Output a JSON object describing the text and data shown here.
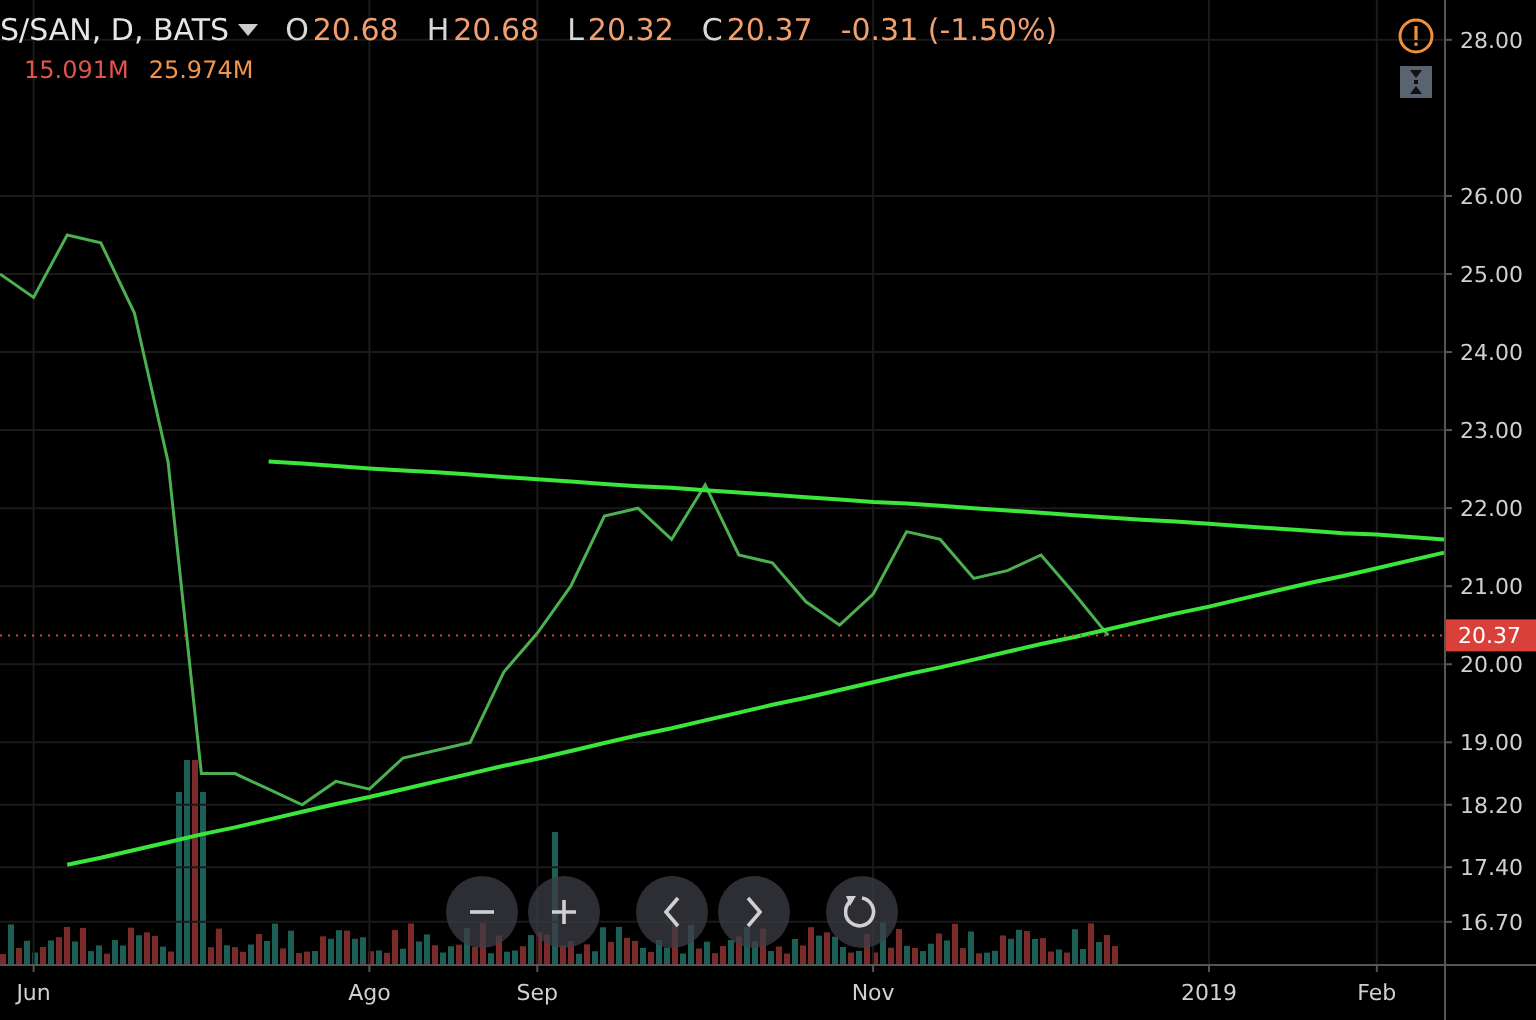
{
  "legend": {
    "symbol": "S/SAN, D, BATS",
    "ohlc": [
      {
        "label": "O",
        "value": "20.68"
      },
      {
        "label": "H",
        "value": "20.68"
      },
      {
        "label": "L",
        "value": "20.32"
      },
      {
        "label": "C",
        "value": "20.37"
      }
    ],
    "change": "-0.31 (-1.50%)",
    "volume": [
      {
        "value": "15.091M",
        "color": "#e0544f"
      },
      {
        "value": "25.974M",
        "color": "#f0954a"
      }
    ]
  },
  "chart_data": {
    "type": "line",
    "grid": true,
    "ylim": [
      16.16,
      28.51
    ],
    "categories": [
      null,
      "Jun",
      null,
      null,
      null,
      null,
      null,
      null,
      null,
      null,
      null,
      "Ago",
      null,
      null,
      null,
      null,
      "Sep",
      null,
      null,
      null,
      null,
      null,
      null,
      null,
      null,
      null,
      "Nov",
      null,
      null,
      null,
      null,
      null,
      null,
      null,
      null,
      null,
      "2019",
      null,
      null,
      null,
      null,
      "Feb",
      null,
      null
    ],
    "series": [
      {
        "color": "#4caf50",
        "values": [
          25.0,
          24.7,
          25.5,
          25.4,
          24.5,
          22.6,
          18.6,
          18.6,
          18.4,
          18.2,
          18.5,
          18.4,
          18.8,
          18.9,
          19.0,
          19.9,
          20.4,
          21.0,
          21.9,
          22.0,
          21.6,
          22.3,
          21.4,
          21.3,
          20.8,
          20.5,
          20.9,
          21.7,
          21.6,
          21.1,
          21.2,
          21.4,
          20.9,
          20.37,
          null,
          null,
          null,
          null,
          null,
          null,
          null,
          null,
          null,
          null
        ]
      },
      {
        "color": "#39e639",
        "values": [
          null,
          null,
          null,
          null,
          null,
          null,
          null,
          null,
          22.6,
          22.57,
          22.54,
          22.51,
          22.48,
          22.46,
          22.43,
          22.4,
          22.37,
          22.34,
          22.31,
          22.28,
          22.26,
          22.23,
          22.2,
          22.17,
          22.14,
          22.11,
          22.08,
          22.06,
          22.03,
          22.0,
          21.97,
          21.94,
          21.91,
          21.88,
          21.85,
          21.83,
          21.8,
          21.77,
          21.74,
          21.71,
          21.68,
          21.66,
          21.63,
          21.6
        ]
      },
      {
        "color": "#39e639",
        "values": [
          null,
          null,
          17.43,
          17.52,
          17.62,
          17.72,
          17.82,
          17.91,
          18.01,
          18.11,
          18.21,
          18.3,
          18.4,
          18.5,
          18.6,
          18.7,
          18.79,
          18.89,
          18.99,
          19.09,
          19.18,
          19.28,
          19.38,
          19.48,
          19.57,
          19.67,
          19.77,
          19.87,
          19.96,
          20.06,
          20.16,
          20.26,
          20.35,
          20.45,
          20.55,
          20.65,
          20.74,
          20.84,
          20.94,
          21.04,
          21.13,
          21.23,
          21.33,
          21.43
        ]
      }
    ],
    "yticks": [
      {
        "value": 28,
        "label": "28.00"
      },
      {
        "value": 26,
        "label": "26.00"
      },
      {
        "value": 25,
        "label": "25.00"
      },
      {
        "value": 24,
        "label": "24.00"
      },
      {
        "value": 23,
        "label": "23.00"
      },
      {
        "value": 22,
        "label": "22.00"
      },
      {
        "value": 21,
        "label": "21.00"
      },
      {
        "value": 20,
        "label": "20.00"
      },
      {
        "value": 19,
        "label": "19.00"
      },
      {
        "value": 18.2,
        "label": "18.20"
      },
      {
        "value": 17.4,
        "label": "17.40"
      },
      {
        "value": 16.7,
        "label": "16.70"
      }
    ],
    "ref_lines": [
      {
        "axis": "y",
        "value": 20.37,
        "label": "20.37",
        "color": "#d9403a"
      }
    ]
  },
  "buttons": [
    {
      "kind": "zoom-out"
    },
    {
      "kind": "zoom-in"
    },
    {
      "kind": "scroll-left"
    },
    {
      "kind": "scroll-right"
    },
    {
      "kind": "reset"
    }
  ]
}
